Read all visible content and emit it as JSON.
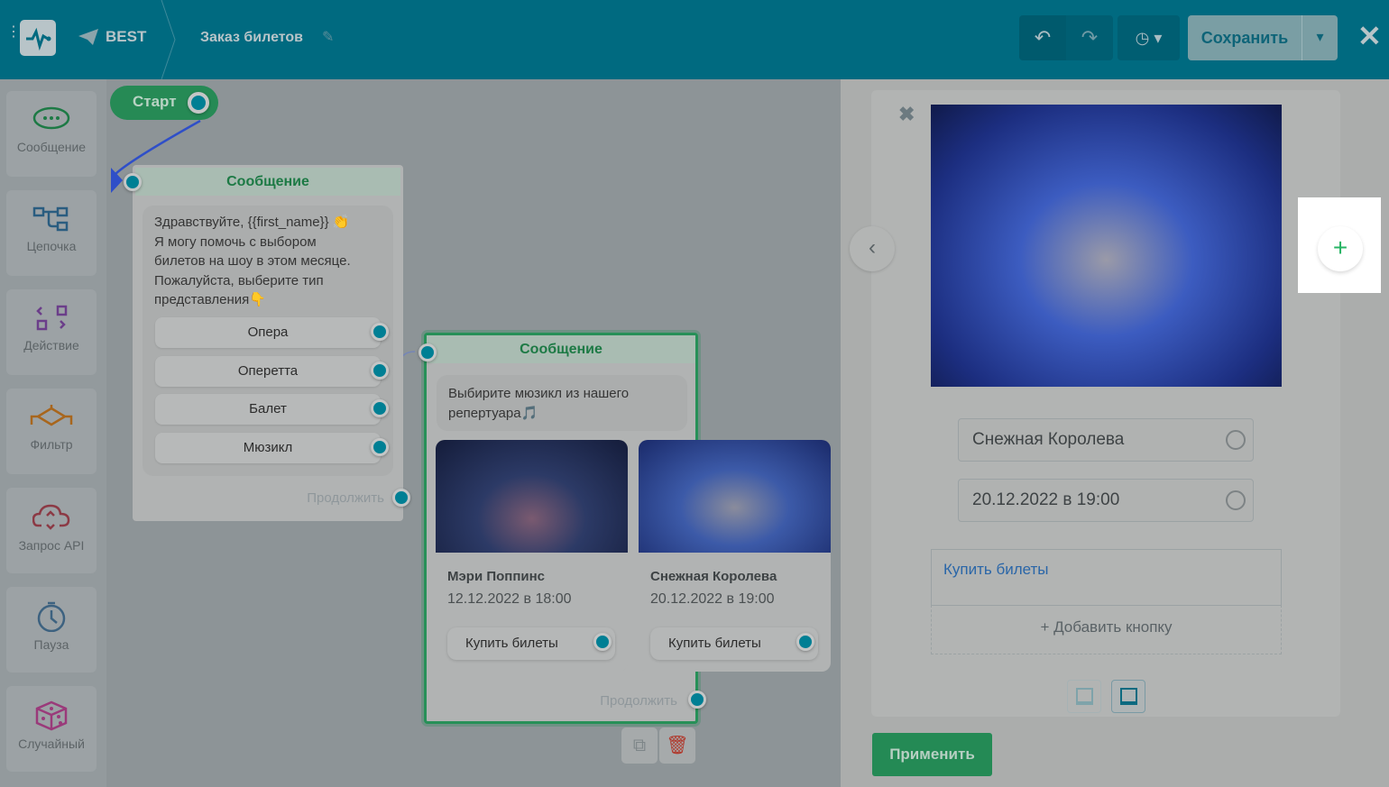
{
  "header": {
    "bot_name": "BEST",
    "flow_name": "Заказ билетов",
    "save_label": "Сохранить"
  },
  "sidebar": {
    "items": [
      {
        "label": "Сообщение",
        "icon": "chat-bubble-icon",
        "color": "#1d7a45"
      },
      {
        "label": "Цепочка",
        "icon": "chain-icon",
        "color": "#2a5d80"
      },
      {
        "label": "Действие",
        "icon": "action-icon",
        "color": "#6b3e8a"
      },
      {
        "label": "Фильтр",
        "icon": "filter-icon",
        "color": "#a8661d"
      },
      {
        "label": "Запрос API",
        "icon": "cloud-api-icon",
        "color": "#8c3a45"
      },
      {
        "label": "Пауза",
        "icon": "stopwatch-icon",
        "color": "#3d6280"
      },
      {
        "label": "Случайный",
        "icon": "dice-icon",
        "color": "#9a3a7a"
      }
    ]
  },
  "canvas": {
    "start_label": "Старт",
    "node1": {
      "title": "Сообщение",
      "text_lines": [
        "Здравствуйте,  {{first_name}} 👏",
        "Я могу помочь с выбором",
        "билетов на шоу в этом месяце.",
        "Пожалуйста, выберите тип",
        "представления👇"
      ],
      "options": [
        "Опера",
        "Оперетта",
        "Балет",
        "Мюзикл"
      ],
      "continue": "Продолжить"
    },
    "node2": {
      "title": "Сообщение",
      "text_lines": [
        "Выбирите мюзикл из нашего",
        "репертуара🎵"
      ],
      "cards": [
        {
          "title": "Мэри Поппинс",
          "date": "12.12.2022 в 18:00",
          "button": "Купить билеты"
        },
        {
          "title": "Снежная Королева",
          "date": "20.12.2022 в 19:00",
          "button": "Купить билеты"
        }
      ],
      "continue": "Продолжить"
    }
  },
  "editor": {
    "title_value": "Снежная Королева",
    "subtitle_value": "20.12.2022 в 19:00",
    "button_label": "Купить билеты",
    "add_button": "+ Добавить кнопку",
    "apply": "Применить"
  }
}
